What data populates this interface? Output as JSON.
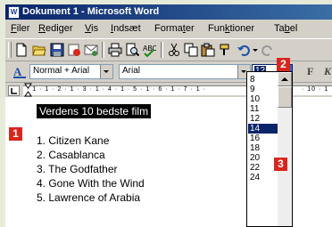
{
  "window": {
    "title": "Dokument 1 - Microsoft Word",
    "app_icon": "W"
  },
  "menu": [
    {
      "pre": "",
      "key": "F",
      "post": "iler"
    },
    {
      "pre": "",
      "key": "R",
      "post": "ediger"
    },
    {
      "pre": "",
      "key": "V",
      "post": "is"
    },
    {
      "pre": "",
      "key": "I",
      "post": "ndsæt"
    },
    {
      "pre": "Forma",
      "key": "t",
      "post": "er"
    },
    {
      "pre": "Fun",
      "key": "k",
      "post": "tioner"
    },
    {
      "pre": "Ta",
      "key": "b",
      "post": "el"
    }
  ],
  "formatting": {
    "style_value": "Normal + Arial",
    "font_value": "Arial",
    "size_value": "12",
    "bold_label": "F",
    "italic_label": "K"
  },
  "ruler": {
    "marks": "· 1 · 1 · 2 · 1 · 3 · 1 · 4 · 1 · 5 · 1 · 6 · 1 · 7 · 1 ·",
    "marks_right": "· 10 · 1"
  },
  "document": {
    "heading": "Verdens 10 bedste film",
    "films": [
      "1. Citizen Kane",
      "2. Casablanca",
      "3. The Godfather",
      "4. Gone With the Wind",
      "5. Lawrence of Arabia"
    ]
  },
  "size_list": {
    "options": [
      "8",
      "9",
      "10",
      "11",
      "12",
      "14",
      "16",
      "18",
      "20",
      "22",
      "24"
    ],
    "selected": "14"
  },
  "badges": {
    "heading": "1",
    "size_dropdown": "2",
    "size_option": "3"
  },
  "colors": {
    "badge": "#d9261c",
    "selection": "#0a246a",
    "title_bar": "#0a246a"
  }
}
